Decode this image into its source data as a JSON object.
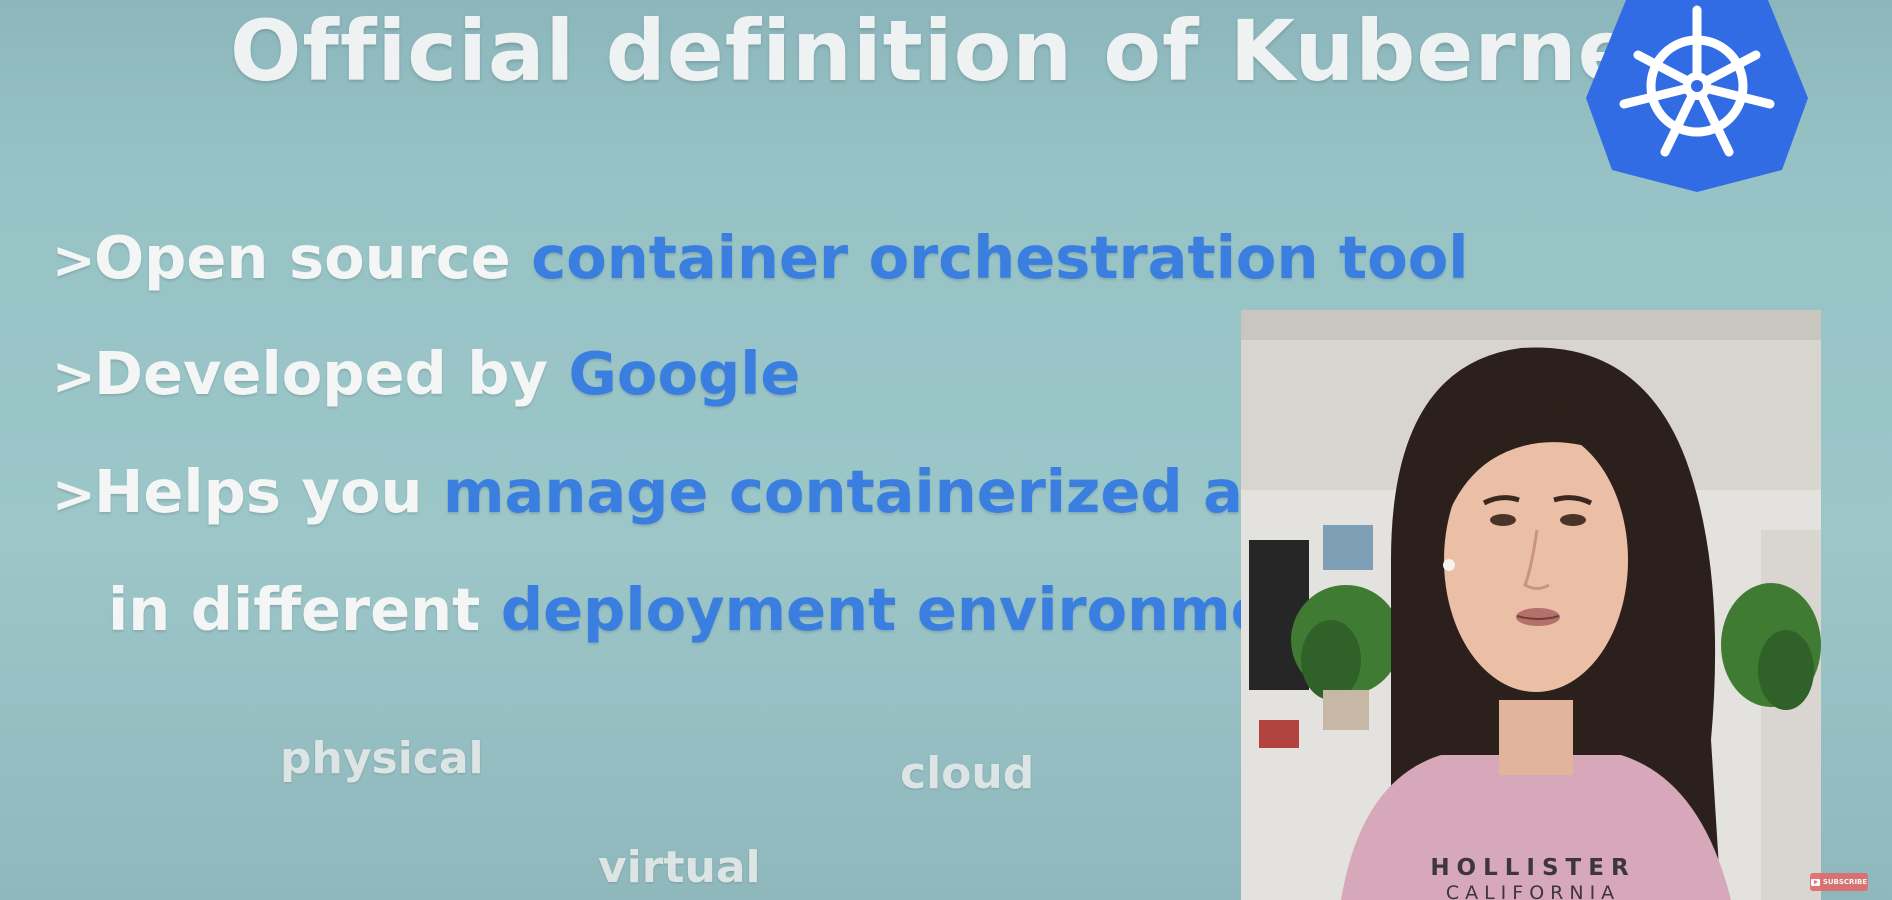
{
  "slide": {
    "title": "Official definition of Kubernetes",
    "bullets": [
      {
        "marker": ">",
        "plain": "Open source ",
        "highlight": "container orchestration tool"
      },
      {
        "marker": ">",
        "plain": "Developed by ",
        "highlight": "Google"
      },
      {
        "marker": ">",
        "plain": "Helps you ",
        "highlight": "manage containerized applications"
      }
    ],
    "continuation": {
      "plain": "in different ",
      "highlight": "deployment environments"
    },
    "environments": {
      "physical": "physical",
      "cloud": "cloud",
      "virtual": "virtual"
    }
  },
  "logo": {
    "icon": "kubernetes-helm-wheel-icon",
    "color": "#326ce5"
  },
  "overlay": {
    "subscribe_label": "SUBSCRIBE",
    "subscribe_icon": "youtube-play-icon"
  },
  "webcam": {
    "shirt_text_line1": "HOLLISTER",
    "shirt_text_line2": "CALIFORNIA"
  },
  "colors": {
    "background": "#97c3c6",
    "title_text": "#eef2f2",
    "highlight": "#3a7fe0"
  }
}
